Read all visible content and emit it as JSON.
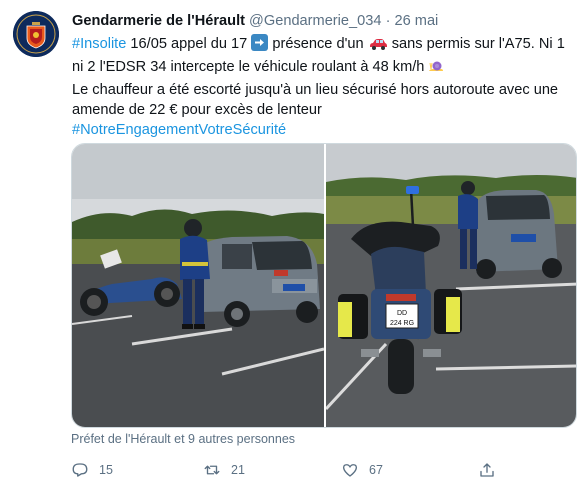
{
  "tweet": {
    "author": {
      "display_name": "Gendarmerie de l'Hérault",
      "handle": "@Gendarmerie_034",
      "separator": "·",
      "date": "26 mai"
    },
    "text": {
      "line1_hashtag": "#Insolite",
      "line1_a": " 16/05 appel du 17 ",
      "line1_b": " présence d'un ",
      "line1_c": " sans permis sur l'A75. Ni 1",
      "line2_a": "ni 2 l'EDSR 34 intercepte le véhicule roulant à 48 km/h ",
      "line3": "Le chauffeur a été escorté jusqu'à un lieu sécurisé hors autoroute avec une",
      "line4": "amende de 22 € pour excès de lenteur",
      "line5_hashtag": "#NotreEngagementVotreSécurité"
    },
    "emojis": [
      "arrow-right-icon",
      "red-car-icon",
      "snail-icon"
    ],
    "media": {
      "left_photo_plate": "",
      "right_photo_plate_1": "DD",
      "right_photo_plate_2": "224 RG"
    },
    "liked_by": "Préfet de l'Hérault et 9 autres personnes",
    "actions": {
      "replies": "15",
      "retweets": "21",
      "likes": "67"
    },
    "colors": {
      "link": "#1b95e0",
      "secondary_text": "#5b7083"
    }
  }
}
